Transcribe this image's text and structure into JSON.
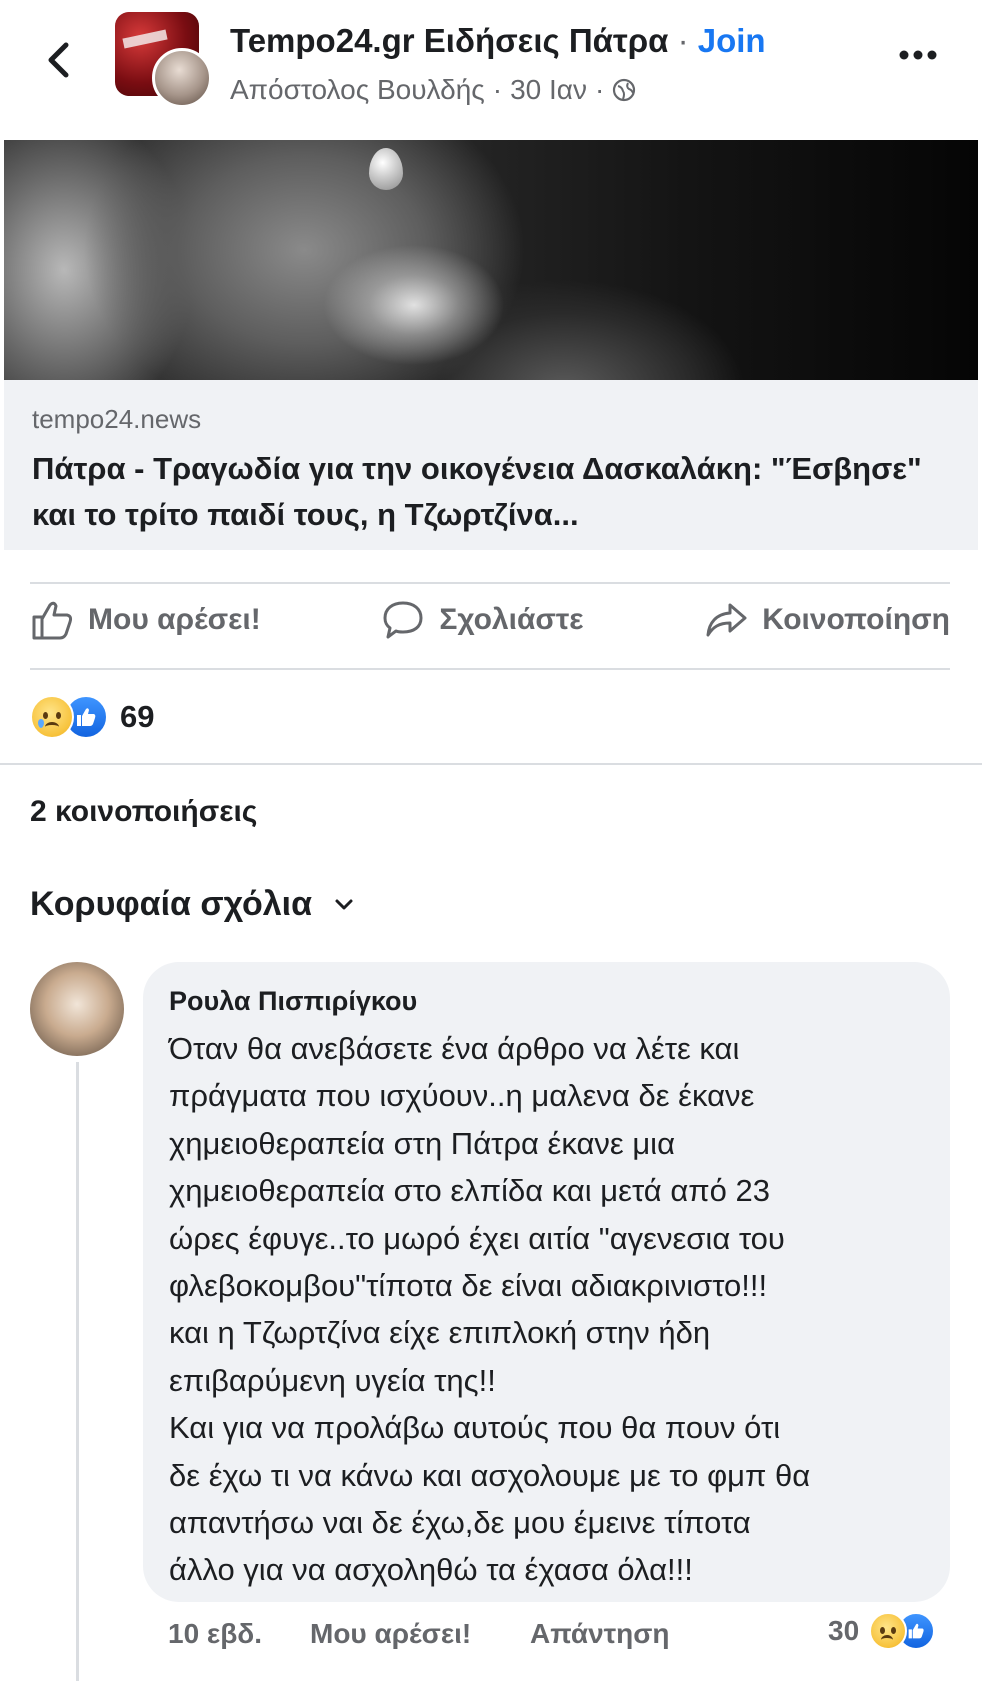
{
  "header": {
    "group_name": "Tempo24.gr Ειδήσεις Πάτρα",
    "separator": " · ",
    "join_label": "Join",
    "author": "Απόστολος Βουλδής",
    "date": "30 Ιαν",
    "dot": "·",
    "privacy_icon": "globe-icon",
    "back_icon": "chevron-left-icon",
    "more_icon": "more-horizontal-icon"
  },
  "link": {
    "domain": "tempo24.news",
    "title": "Πάτρα - Τραγωδία για την οικογένεια Δασκαλάκη: \"Έσβησε\" και το τρίτο παιδί τους, η Τζωρτζίνα..."
  },
  "actions": {
    "like_label": "Μου αρέσει!",
    "comment_label": "Σχολιάστε",
    "share_label": "Κοινοποίηση"
  },
  "reactions": {
    "count": "69",
    "types": [
      "sad-reaction-icon",
      "like-reaction-icon"
    ]
  },
  "shares_label": "2 κοινοποιήσεις",
  "comments_sort_label": "Κορυφαία σχόλια",
  "comment": {
    "author": "Ρουλα Πισπιρίγκου",
    "lines": [
      "Όταν θα ανεβάσετε ένα άρθρο να λέτε και",
      "πράγματα που ισχύουν..η μαλενα δε έκανε",
      "χημειοθεραπεία στη Πάτρα έκανε μια",
      "χημειοθεραπεία στο ελπίδα και μετά από 23",
      "ώρες έφυγε..το μωρό έχει αιτία \"αγενεσια του",
      "φλεβοκομβου\"τίποτα δε είναι αδιακρινιστο!!!",
      "και η Τζωρτζίνα είχε επιπλοκή στην ήδη",
      "επιβαρύμενη υγεία της!!",
      "Και για να προλάβω αυτούς που θα πουν ότι",
      "δε έχω τι να κάνω και ασχολουμε με το φμπ θα",
      "απαντήσω ναι δε έχω,δε μου έμεινε τίποτα",
      "άλλο για να ασχοληθώ τα έχασα όλα!!!"
    ],
    "time": "10 εβδ.",
    "like_label": "Μου αρέσει!",
    "reply_label": "Απάντηση",
    "reaction_count": "30"
  },
  "colors": {
    "accent": "#1877f2",
    "secondary_text": "#65676b",
    "bubble": "#f0f2f5"
  }
}
